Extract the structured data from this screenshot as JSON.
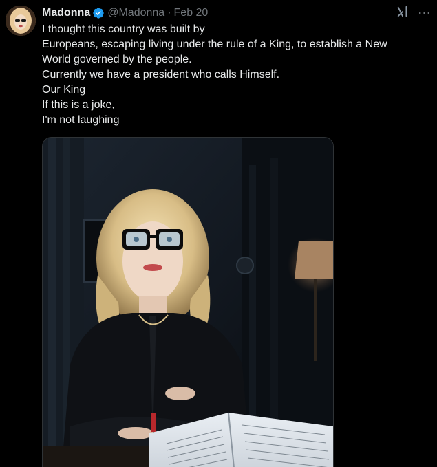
{
  "author": {
    "display_name": "Madonna",
    "handle": "@Madonna",
    "separator": "·",
    "date": "Feb 20",
    "verified_color": "#1d9bf0"
  },
  "tweet": {
    "lines": [
      "I thought this country was built by",
      "Europeans, escaping living under the rule of a King, to establish a New",
      "World governed by the people.",
      "Currently we have a president who calls Himself.",
      "Our King",
      "If this is a joke,",
      "I'm not laughing"
    ]
  },
  "icons": {
    "verified": "verified-badge-icon",
    "grok": "grok-icon",
    "more": "more-options-icon"
  },
  "colors": {
    "background": "#000000",
    "text": "#e7e9ea",
    "secondary": "#71767b",
    "accent": "#1d9bf0"
  }
}
